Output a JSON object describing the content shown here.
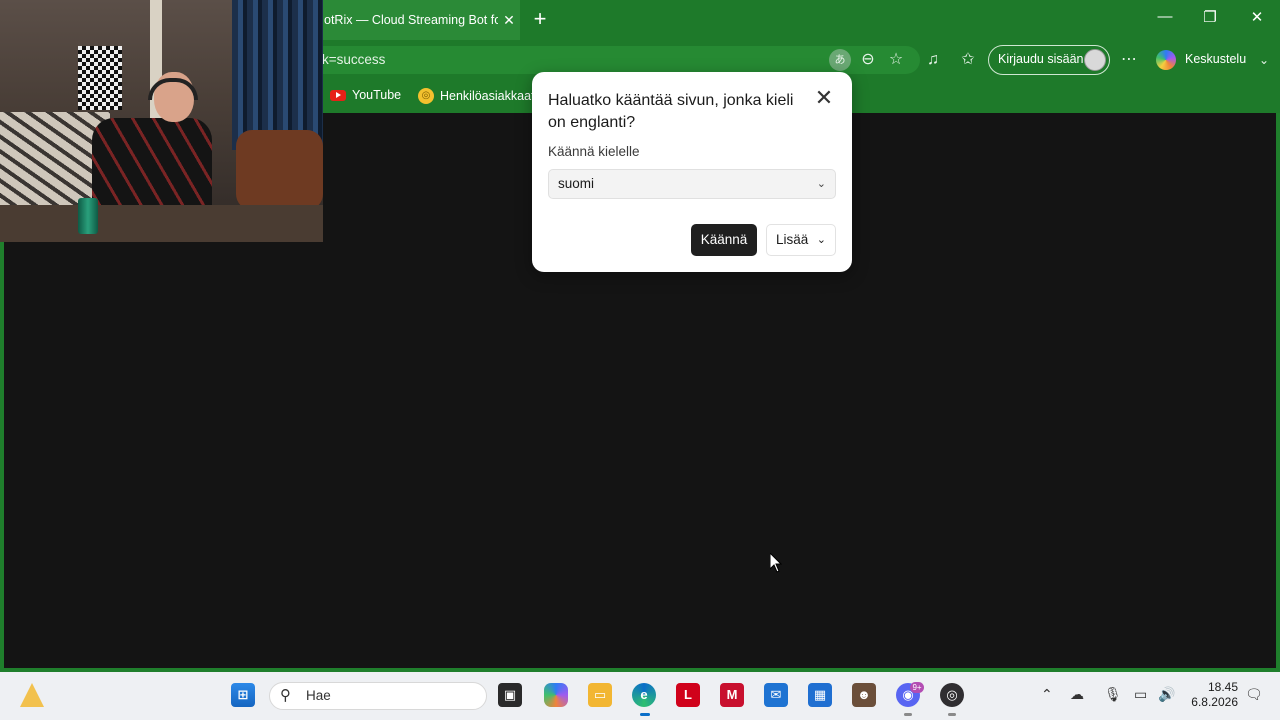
{
  "browser": {
    "tab_title": "otRix — Cloud Streaming Bot for",
    "tab_close": "✕",
    "new_tab": "+",
    "url": "k=success",
    "signin_label": "Kirjaudu sisään",
    "copilot_label": "Keskustelu",
    "bookmarks": [
      {
        "label": "YouTube",
        "icon": "youtube-icon"
      },
      {
        "label": "Henkilöasiakkaat",
        "icon": "bank-icon"
      }
    ],
    "window_controls": {
      "minimize": "—",
      "restore": "❐",
      "close": "✕"
    },
    "theme_color": "#1e7a2a"
  },
  "translate_popup": {
    "title": "Haluatko kääntää sivun, jonka kieli on englanti?",
    "target_label": "Käännä kielelle",
    "selected_language": "suomi",
    "translate_button": "Käännä",
    "more_button": "Lisää",
    "close": "✕"
  },
  "taskbar": {
    "search_placeholder": "Hae",
    "time": "18.45",
    "date": "6.8.2026",
    "notification_badge": "9+",
    "apps": [
      "widgets-icon",
      "start-icon",
      "task-view-icon",
      "copilot-icon",
      "file-explorer-icon",
      "edge-icon",
      "lastpass-icon",
      "mcafee-icon",
      "outlook-icon",
      "store-icon",
      "game-icon",
      "discord-icon",
      "obs-icon"
    ]
  }
}
